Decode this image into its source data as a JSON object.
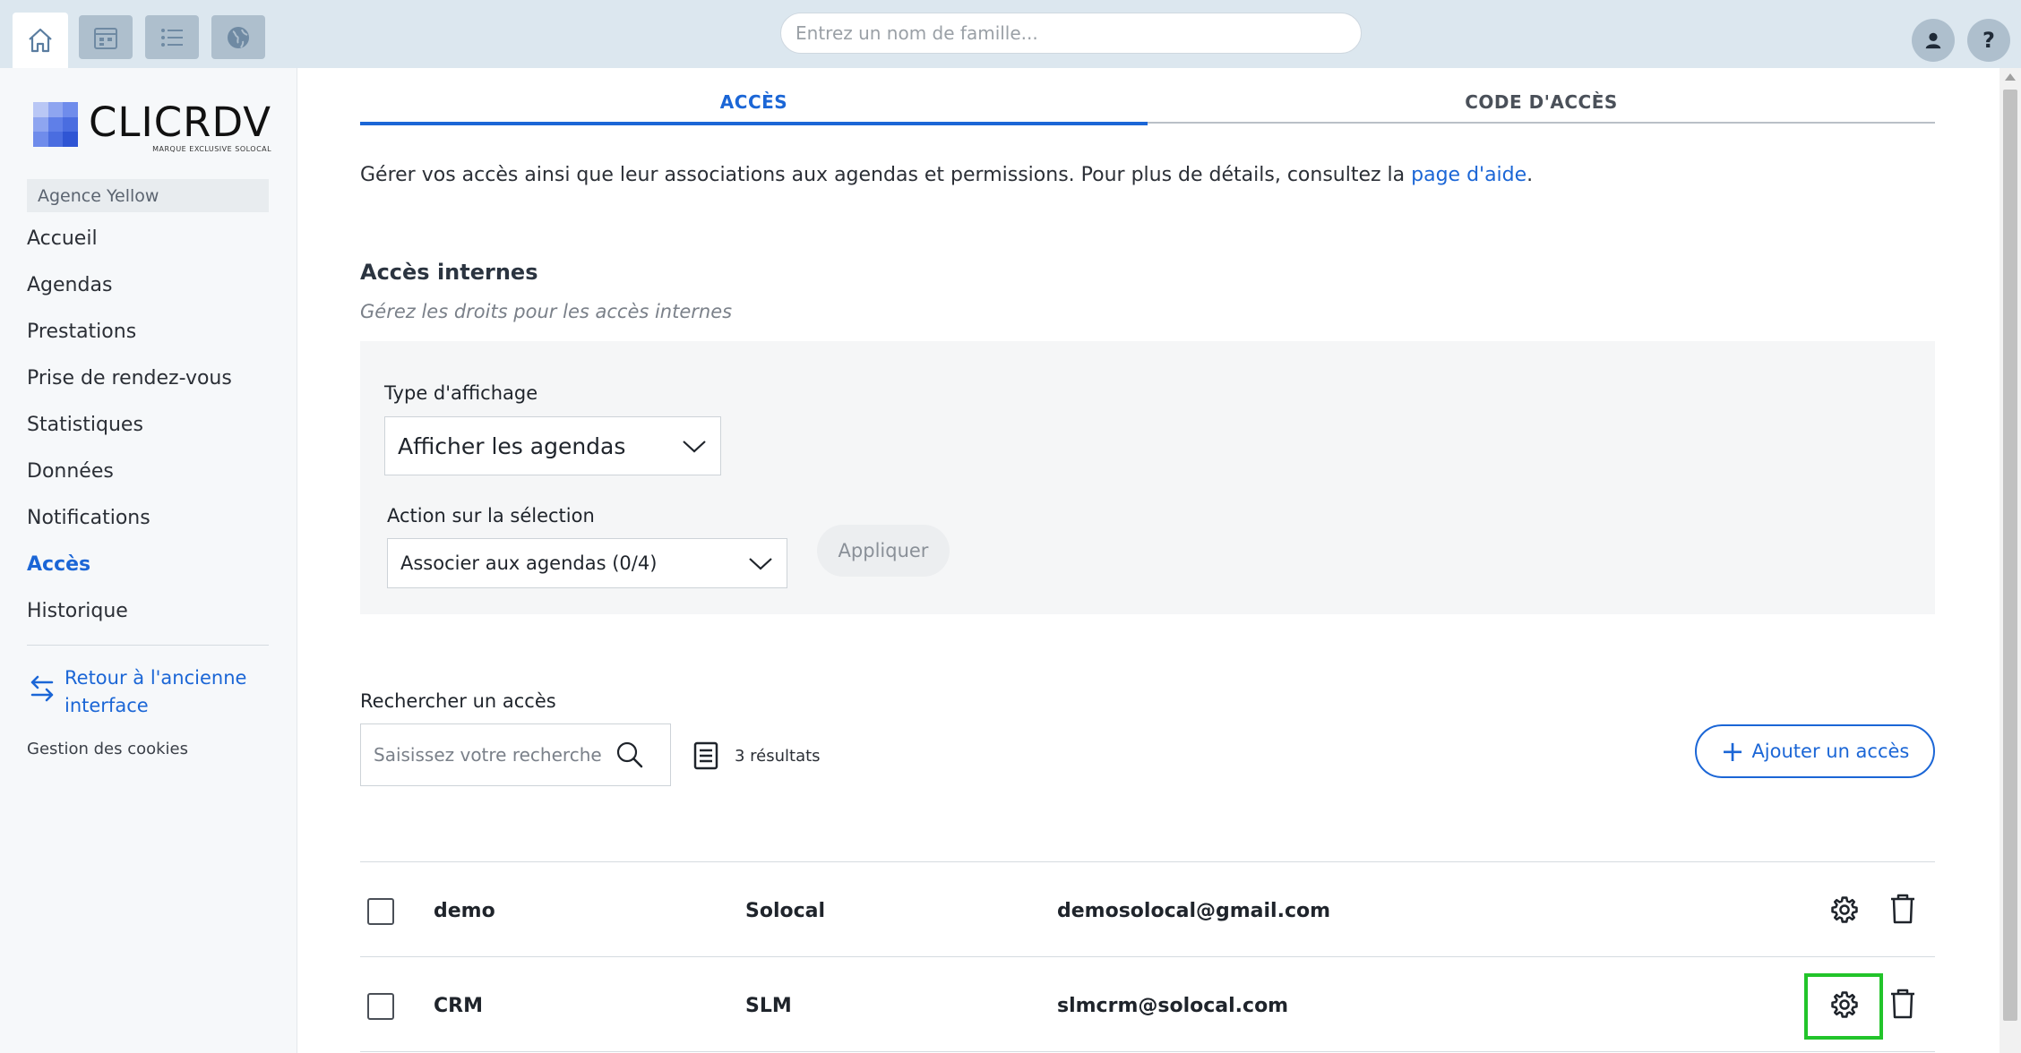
{
  "topbar": {
    "search_placeholder": "Entrez un nom de famille...",
    "icons": [
      "home-icon",
      "calendar-icon",
      "list-icon",
      "globe-icon"
    ],
    "help_label": "?"
  },
  "sidebar": {
    "logo_text": "CLICRDV",
    "logo_sub": "MARQUE EXCLUSIVE SOLOCAL",
    "agency": "Agence Yellow",
    "items": [
      {
        "label": "Accueil"
      },
      {
        "label": "Agendas"
      },
      {
        "label": "Prestations"
      },
      {
        "label": "Prise de rendez-vous"
      },
      {
        "label": "Statistiques"
      },
      {
        "label": "Données"
      },
      {
        "label": "Notifications"
      },
      {
        "label": "Accès"
      },
      {
        "label": "Historique"
      }
    ],
    "active_item": "Accès",
    "back_link": "Retour à l'ancienne interface",
    "cookies": "Gestion des cookies"
  },
  "main": {
    "tabs": [
      {
        "label": "ACCÈS"
      },
      {
        "label": "CODE D'ACCÈS"
      }
    ],
    "intro_text": "Gérer vos accès ainsi que leur associations aux agendas et permissions. Pour plus de détails, consultez la ",
    "intro_link": "page d'aide",
    "intro_end": ".",
    "section_title": "Accès internes",
    "section_subtitle": "Gérez les droits pour les accès internes",
    "display_type_label": "Type d'affichage",
    "display_type_value": "Afficher les agendas",
    "action_label": "Action sur la sélection",
    "action_value": "Associer aux agendas (0/4)",
    "apply_label": "Appliquer",
    "search_label": "Rechercher un accès",
    "search_placeholder": "Saisissez votre recherche",
    "results_count": "3 résultats",
    "add_button": "Ajouter un accès",
    "rows": [
      {
        "name": "demo",
        "company": "Solocal",
        "email": "demosolocal@gmail.com"
      },
      {
        "name": "CRM",
        "company": "SLM",
        "email": "slmcrm@solocal.com"
      }
    ]
  },
  "colors": {
    "accent": "#1b66d6",
    "topbar_bg": "#dce7ef",
    "highlight": "#22c42a"
  }
}
